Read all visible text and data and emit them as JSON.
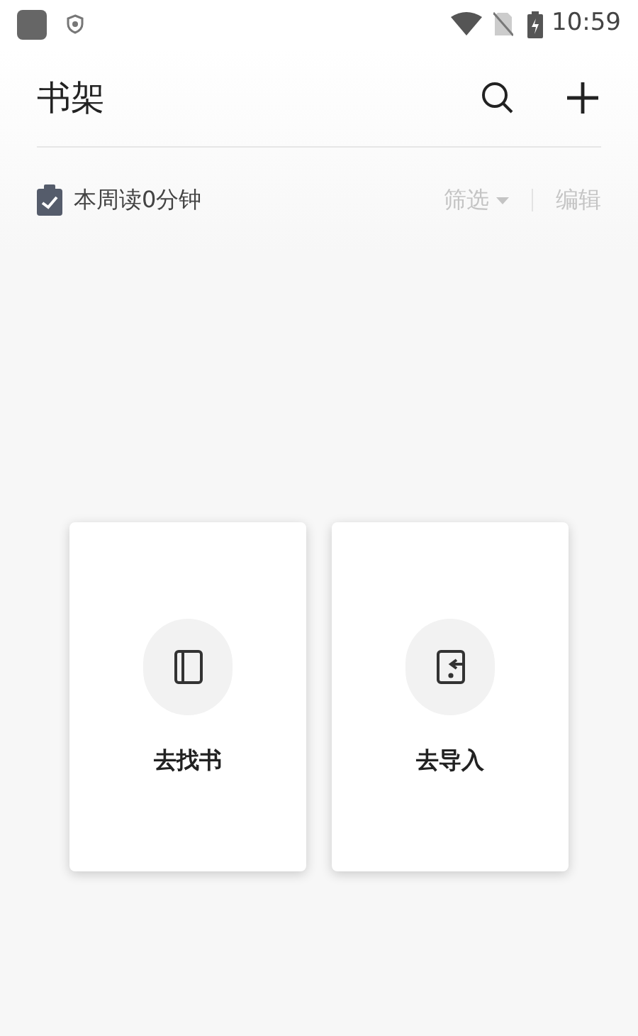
{
  "status_bar": {
    "time": "10:59"
  },
  "header": {
    "title": "书架"
  },
  "reading_summary": {
    "text": "本周读0分钟"
  },
  "toolbar": {
    "filter": "筛选",
    "edit": "编辑"
  },
  "cards": [
    {
      "kind": "book",
      "label": "去找书"
    },
    {
      "kind": "import",
      "label": "去导入"
    }
  ]
}
